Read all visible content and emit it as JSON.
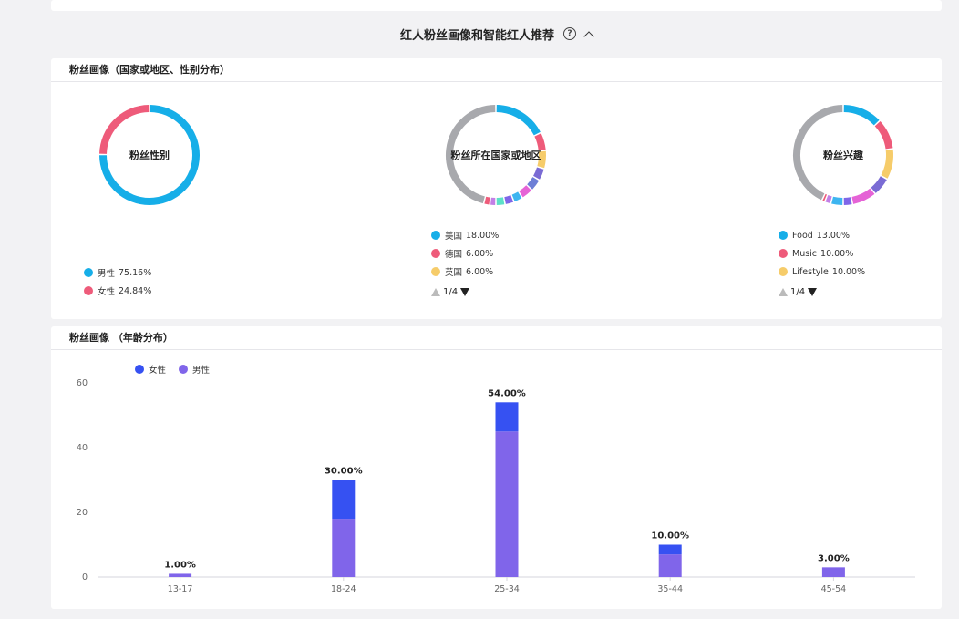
{
  "section": {
    "title": "红人粉丝画像和智能红人推荐"
  },
  "profile_card": {
    "title": "粉丝画像（国家或地区、性别分布）",
    "gender": {
      "label": "粉丝性别",
      "items": [
        {
          "name": "男性",
          "value": "75.16%",
          "pct": 75.16,
          "color": "#16aee8"
        },
        {
          "name": "女性",
          "value": "24.84%",
          "pct": 24.84,
          "color": "#ee5b7a"
        }
      ]
    },
    "country": {
      "label": "粉丝所在国家或地区",
      "items": [
        {
          "name": "美国",
          "value": "18.00%",
          "color": "#16aee8"
        },
        {
          "name": "德国",
          "value": "6.00%",
          "color": "#ee5b7a"
        },
        {
          "name": "英国",
          "value": "6.00%",
          "color": "#f6cc6a"
        }
      ],
      "pager": "1/4"
    },
    "interest": {
      "label": "粉丝兴趣",
      "items": [
        {
          "name": "Food",
          "value": "13.00%",
          "color": "#16aee8"
        },
        {
          "name": "Music",
          "value": "10.00%",
          "color": "#ee5b7a"
        },
        {
          "name": "Lifestyle",
          "value": "10.00%",
          "color": "#f6cc6a"
        }
      ],
      "pager": "1/4"
    }
  },
  "age_card": {
    "title": "粉丝画像 （年龄分布）"
  },
  "chart_data": [
    {
      "type": "pie",
      "categories": [
        "男性",
        "女性"
      ],
      "values": [
        75.16,
        24.84
      ],
      "colors": [
        "#16aee8",
        "#ee5b7a"
      ]
    },
    {
      "type": "pie",
      "categories": [
        "美国",
        "德国",
        "英国"
      ],
      "values": [
        18,
        6,
        6
      ],
      "colors": [
        "#16aee8",
        "#ee5b7a",
        "#f6cc6a"
      ]
    },
    {
      "type": "pie",
      "categories": [
        "Food",
        "Music",
        "Lifestyle"
      ],
      "values": [
        13,
        10,
        10
      ],
      "colors": [
        "#16aee8",
        "#ee5b7a",
        "#f6cc6a"
      ]
    },
    {
      "type": "bar",
      "stacked": true,
      "categories": [
        "13-17",
        "18-24",
        "25-34",
        "35-44",
        "45-54"
      ],
      "series": [
        {
          "name": "男性",
          "color": "#8065ea",
          "values": [
            1,
            18,
            45,
            7,
            3
          ]
        },
        {
          "name": "女性",
          "color": "#3651f2",
          "values": [
            0,
            12,
            9,
            3,
            0
          ]
        }
      ],
      "totals": [
        "1.00%",
        "30.00%",
        "54.00%",
        "10.00%",
        "3.00%"
      ],
      "yticks": [
        0,
        20,
        40,
        60
      ],
      "ylim": [
        0,
        60
      ],
      "legend_order": [
        "女性",
        "男性"
      ],
      "legend": "top-left"
    }
  ]
}
